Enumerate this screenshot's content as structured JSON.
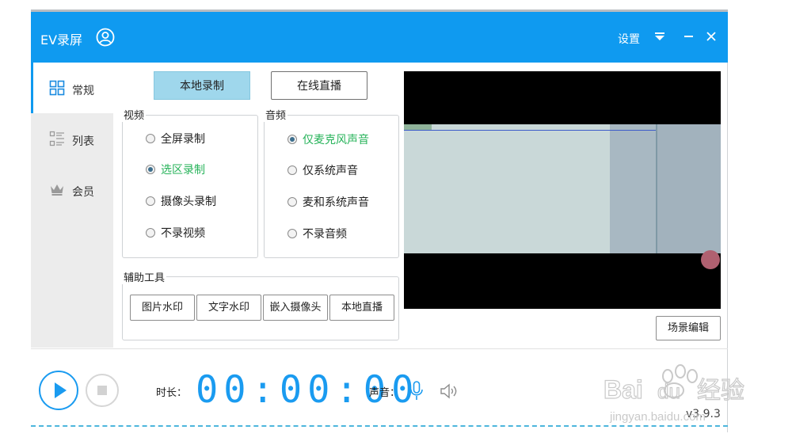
{
  "app": {
    "title": "EV录屏",
    "settings_label": "设置",
    "version": "v3.9.3"
  },
  "sidebar": {
    "items": [
      {
        "label": "常规",
        "icon": "grid-icon",
        "active": true
      },
      {
        "label": "列表",
        "icon": "list-icon",
        "active": false
      },
      {
        "label": "会员",
        "icon": "crown-icon",
        "active": false
      }
    ]
  },
  "modes": {
    "local_record": "本地录制",
    "online_live": "在线直播",
    "selected": "本地录制"
  },
  "video": {
    "label": "视频",
    "options": [
      "全屏录制",
      "选区录制",
      "摄像头录制",
      "不录视频"
    ],
    "selected": "选区录制"
  },
  "audio": {
    "label": "音频",
    "options": [
      "仅麦克风声音",
      "仅系统声音",
      "麦和系统声音",
      "不录音频"
    ],
    "selected": "仅麦克风声音"
  },
  "tools": {
    "label": "辅助工具",
    "buttons": [
      "图片水印",
      "文字水印",
      "嵌入摄像头",
      "本地直播"
    ]
  },
  "preview": {
    "scene_edit_label": "场景编辑"
  },
  "bottom": {
    "duration_label": "时长：",
    "timer": "00:00:00",
    "sound_label": "声音："
  },
  "watermark": {
    "brand": "Baidu经验",
    "url": "jingyan.baidu.com"
  },
  "colors": {
    "accent": "#0f9af0",
    "selected_option": "#27b35a",
    "local_button": "#9fd7ec"
  }
}
